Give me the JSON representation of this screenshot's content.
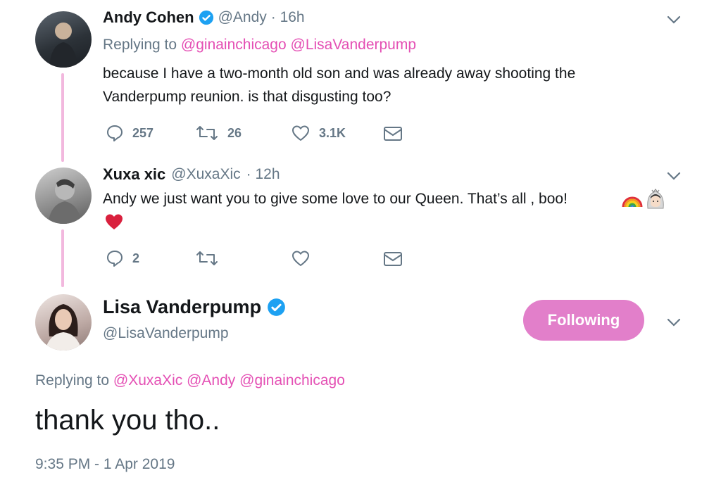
{
  "tweets": [
    {
      "name": "Andy Cohen",
      "handle": "@Andy",
      "time": "· 16h",
      "replying_prefix": "Replying to",
      "replying_mentions": [
        "@ginainchicago",
        "@LisaVanderpump"
      ],
      "text_line1": "because I have a two-month old son and was already away shooting the",
      "text_line2": "Vanderpump reunion.  is that disgusting too?",
      "replies": "257",
      "retweets": "26",
      "likes": "3.1K"
    },
    {
      "name": "Xuxa xic",
      "handle": "@XuxaXic",
      "time": "· 12h",
      "text": "Andy we just want you to give some love to our Queen. That’s all , boo!",
      "replies": "2",
      "retweets": "",
      "likes": ""
    }
  ],
  "main_tweet": {
    "name": "Lisa Vanderpump",
    "handle": "@LisaVanderpump",
    "follow_label": "Following",
    "replying_prefix": "Replying to",
    "replying_mentions": [
      "@XuxaXic",
      "@Andy",
      "@ginainchicago"
    ],
    "text": "thank you tho..",
    "timestamp": "9:35 PM - 1 Apr 2019"
  },
  "colors": {
    "accent": "#e44fb4",
    "button": "#e27fca",
    "thread_line": "#f2b8de",
    "muted": "#657786",
    "verified": "#1da1f2"
  },
  "icons": [
    "reply-icon",
    "retweet-icon",
    "like-icon",
    "dm-icon",
    "chevron-down-icon",
    "verified-badge-icon",
    "rainbow-emoji",
    "bride-emoji",
    "heart-emoji"
  ]
}
